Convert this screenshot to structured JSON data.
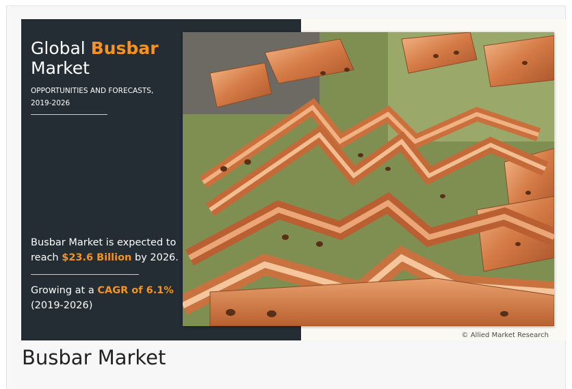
{
  "banner": {
    "title_prefix": "Global",
    "title_accent": "Busbar",
    "title_suffix": "Market",
    "subtitle_line1": "OPPORTUNITIES AND FORECASTS,",
    "subtitle_line2": "2019-2026",
    "stat1_pre": "Busbar Market is expected to reach",
    "stat1_value": "$23.6 Billion",
    "stat1_post": "by 2026.",
    "stat2_pre": "Growing at a",
    "stat2_value": "CAGR of 6.1%",
    "stat2_period": "(2019-2026)",
    "credit": "© Allied Market Research",
    "accent_color": "#f7931e",
    "panel_color": "#232d33"
  },
  "caption": "Busbar Market",
  "photo_subject": "copper-busbars-photo"
}
